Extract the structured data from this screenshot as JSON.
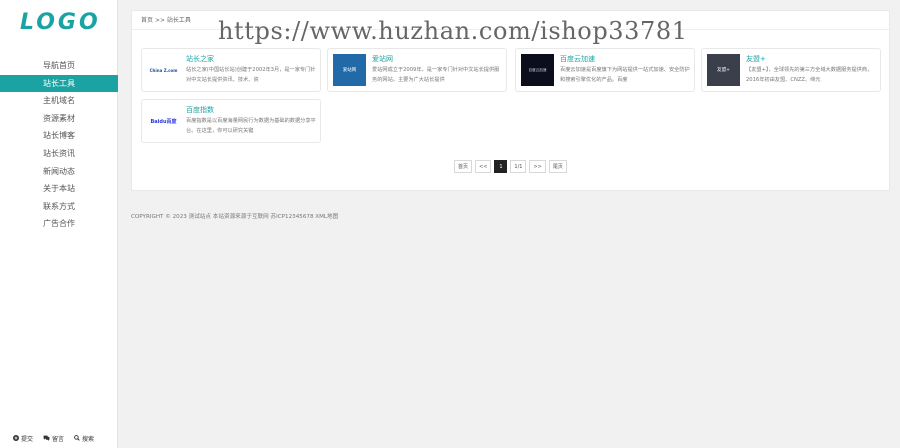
{
  "logo": "LOGO",
  "nav": [
    "导航首页",
    "站长工具",
    "主机域名",
    "资源素材",
    "站长博客",
    "站长资讯",
    "新闻动态",
    "关于本站",
    "联系方式",
    "广告合作"
  ],
  "bottom": {
    "submit": "提交",
    "comment": "留言",
    "search": "搜索"
  },
  "breadcrumb": {
    "home": "首页",
    "sep": ">>",
    "current": "站长工具"
  },
  "watermark": "https://www.huzhan.com/ishop33781",
  "cards": [
    {
      "name": "站长之家",
      "thumb": "China Z.com",
      "desc": "站长之家(中国站长站)创建于2002年3月，是一家专门针对中文站长提供资讯、技术、资"
    },
    {
      "name": "爱站网",
      "thumb": "爱站网",
      "desc": "爱站网成立于2009年，是一家专门针对中文站长提供服务的网站，主要为广大站长提供"
    },
    {
      "name": "百度云加速",
      "thumb": "百度云加速",
      "desc": "百度云加速是百度旗下为网站提供一站式加速、安全防护和搜索引擎优化的产品。百度"
    },
    {
      "name": "友盟+",
      "thumb": "友盟+",
      "desc": "【友盟+】，全球领先的第三方全域大数据服务提供商，2016年初由友盟、CNZZ、缔元"
    },
    {
      "name": "百度指数",
      "thumb": "Baidu百度",
      "desc": "百度指数是以百度海量网民行为数据为基础的数据分享平台。在这里，你可以研究关键"
    }
  ],
  "pager": {
    "first": "首页",
    "prev": "<<",
    "page": "1",
    "total": "1/1",
    "next": ">>",
    "last": "尾页"
  },
  "footer": "COPYRIGHT © 2023 测试站点 本站资源来源于互联网 苏ICP12345678 XML地图",
  "colors": {
    "accent": "#1ba3a3"
  }
}
